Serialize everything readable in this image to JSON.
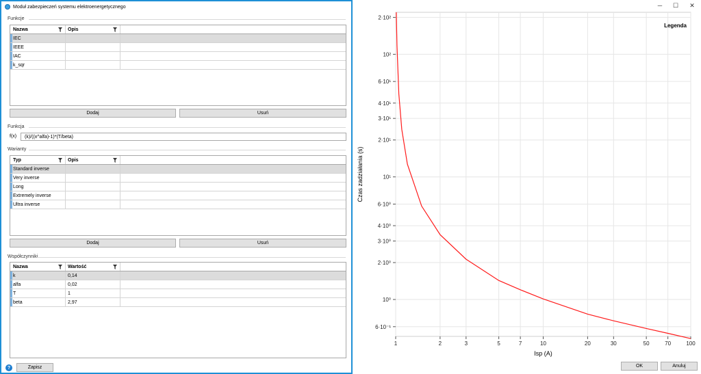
{
  "window": {
    "title": "Moduł zabezpieczeń systemu elektroenergetycznego"
  },
  "functions": {
    "section_label": "Funkcje",
    "columns": [
      "Nazwa",
      "Opis"
    ],
    "rows": [
      [
        "IEC",
        ""
      ],
      [
        "IEEE",
        ""
      ],
      [
        "IAC",
        ""
      ],
      [
        "k_sqr",
        ""
      ]
    ],
    "selected_index": 0,
    "add_label": "Dodaj",
    "remove_label": "Usuń"
  },
  "function_formula": {
    "section_label": "Funkcja",
    "prefix": "f(x)",
    "value": "(k)/((x^alfa)-1)*(T/beta)"
  },
  "variants": {
    "section_label": "Warianty",
    "columns": [
      "Typ",
      "Opis"
    ],
    "rows": [
      [
        "Standard inverse",
        ""
      ],
      [
        "Very inverse",
        ""
      ],
      [
        "Long",
        ""
      ],
      [
        "Extremely inverse",
        ""
      ],
      [
        "Ultra inverse",
        ""
      ]
    ],
    "selected_index": 0,
    "add_label": "Dodaj",
    "remove_label": "Usuń"
  },
  "coefficients": {
    "section_label": "Współczynniki",
    "columns": [
      "Nazwa",
      "Wartość"
    ],
    "rows": [
      [
        "k",
        "0,14"
      ],
      [
        "alfa",
        "0,02"
      ],
      [
        "T",
        "1"
      ],
      [
        "beta",
        "2,97"
      ]
    ],
    "selected_index": 0
  },
  "footer": {
    "save_label": "Zapisz",
    "help_icon": "question-icon"
  },
  "right_window": {
    "minimize": "─",
    "maximize": "☐",
    "close": "✕",
    "ok_label": "OK",
    "cancel_label": "Anuluj"
  },
  "colors": {
    "accent": "#1e90d6",
    "curve": "#ff1a1a"
  },
  "chart_data": {
    "type": "line",
    "title": "",
    "legend_title": "Legenda",
    "xlabel": "Isp (A)",
    "ylabel": "Czas zadziałania (s)",
    "x_scale": "log",
    "y_scale": "log",
    "xlim": [
      1,
      100
    ],
    "ylim": [
      0.5,
      220
    ],
    "x_ticks": [
      1,
      2,
      3,
      5,
      7,
      10,
      20,
      30,
      50,
      70,
      100
    ],
    "x_tick_labels": [
      "1",
      "2",
      "3",
      "5",
      "7",
      "10",
      "20",
      "30",
      "50",
      "70",
      "100"
    ],
    "y_ticks": [
      0.6,
      1,
      2,
      3,
      4,
      6,
      10,
      20,
      30,
      40,
      60,
      100,
      200
    ],
    "y_tick_labels": [
      "6·10⁻¹",
      "10⁰",
      "2·10⁰",
      "3·10⁰",
      "4·10⁰",
      "6·10⁰",
      "10¹",
      "2·10¹",
      "3·10¹",
      "4·10¹",
      "6·10¹",
      "10²",
      "2·10²"
    ],
    "grid": true,
    "series": [
      {
        "x": [
          1.01,
          1.02,
          1.05,
          1.1,
          1.2,
          1.5,
          2,
          3,
          5,
          7,
          10,
          20,
          30,
          50,
          70,
          100
        ],
        "y": [
          236,
          118,
          47.6,
          24.4,
          12.7,
          5.78,
          3.38,
          2.13,
          1.43,
          1.2,
          1.01,
          0.76,
          0.67,
          0.58,
          0.53,
          0.48
        ]
      }
    ]
  }
}
